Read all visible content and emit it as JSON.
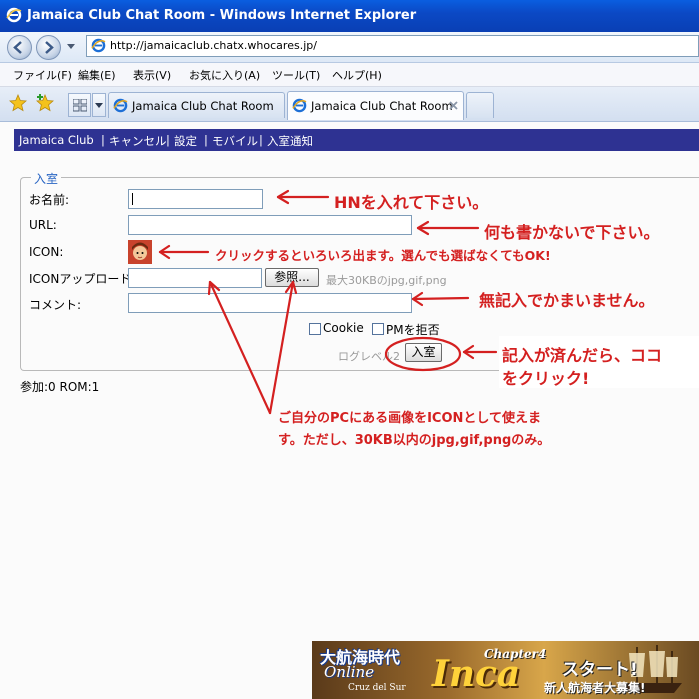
{
  "window": {
    "title": "Jamaica Club Chat Room - Windows Internet Explorer"
  },
  "address": {
    "url": "http://jamaicaclub.chatx.whocares.jp/"
  },
  "menu": [
    "ファイル(F)",
    "編集(E)",
    "表示(V)",
    "お気に入り(A)",
    "ツール(T)",
    "ヘルプ(H)"
  ],
  "tabs": [
    {
      "label": "Jamaica Club Chat Room",
      "active": false
    },
    {
      "label": "Jamaica Club Chat Room",
      "active": true
    }
  ],
  "site_nav": [
    "Jamaica Club",
    "キャンセル",
    "設定",
    "モバイル",
    "入室通知"
  ],
  "nav_separator": "|",
  "form": {
    "legend": "入室",
    "name_label": "お名前:",
    "url_label": "URL:",
    "icon_label": "ICON:",
    "icon_upload_label": "ICONアップロード:",
    "browse_button": "参照...",
    "upload_hint": "最大30KBのjpg,gif,png",
    "comment_label": "コメント:",
    "cookie_label": "Cookie",
    "pm_label": "PMを拒否",
    "log_level": "ログレベル2",
    "enter_button": "入室"
  },
  "status_line": "参加:0 ROM:1",
  "annotations": {
    "hn": "HNを入れて下さい。",
    "url": "何も書かないで下さい。",
    "icon": "クリックするといろいろ出ます。選んでも選ばなくてもOK!",
    "comment": "無記入でかまいません。",
    "enter_1": "記入が済んだら、ココ",
    "enter_2": "をクリック!",
    "upload_1": "ご自分のPCにある画像をICONとして使えま",
    "upload_2": "す。ただし、30KB以内のjpg,gif,pngのみ。"
  },
  "banner": {
    "title": "大航海時代",
    "online": "Online",
    "sub": "Cruz del Sur",
    "chapter": "Chapter4",
    "inca": "Inca",
    "start": "スタート!",
    "recruit": "新人航海者大募集!"
  },
  "colors": {
    "annotation": "#d42020",
    "nav_bar": "#2e3292",
    "legend": "#2a66c4"
  }
}
